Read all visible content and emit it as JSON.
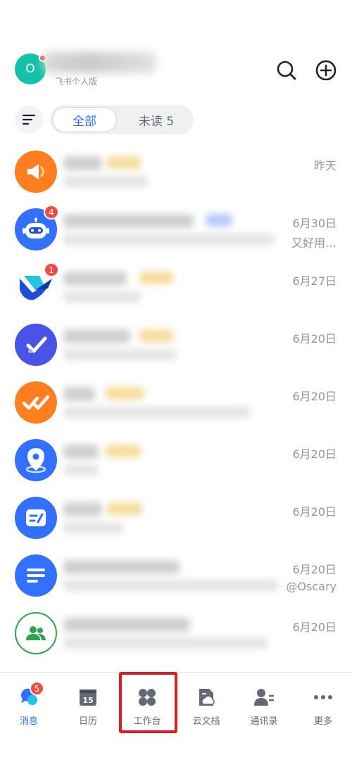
{
  "header": {
    "avatar_letter": "O",
    "org_label": "飞书个人版",
    "search_icon": "search-icon",
    "add_icon": "add-circle-icon"
  },
  "filters": {
    "all_label": "全部",
    "unread_label": "未读 5"
  },
  "chats": [
    {
      "time": "昨天",
      "preview": "",
      "badge": "",
      "icon": "megaphone-icon",
      "color": "#ff7f1e"
    },
    {
      "time": "6月30日",
      "preview": "又好用…",
      "badge": "4",
      "icon": "robot-icon",
      "color": "#3370ff"
    },
    {
      "time": "6月27日",
      "preview": "",
      "badge": "1",
      "icon": "lark-logo-icon",
      "color": "#ffffff"
    },
    {
      "time": "6月20日",
      "preview": "",
      "badge": "",
      "icon": "check-icon",
      "color": "#4954e6"
    },
    {
      "time": "6月20日",
      "preview": "",
      "badge": "",
      "icon": "double-check-icon",
      "color": "#ff7f1e"
    },
    {
      "time": "6月20日",
      "preview": "",
      "badge": "",
      "icon": "location-pin-icon",
      "color": "#3370ff"
    },
    {
      "time": "6月20日",
      "preview": "",
      "badge": "",
      "icon": "note-edit-icon",
      "color": "#3370ff"
    },
    {
      "time": "6月20日",
      "preview": "@Oscary",
      "badge": "",
      "icon": "doc-lines-icon",
      "color": "#3370ff"
    },
    {
      "time": "6月20日",
      "preview": "",
      "badge": "",
      "icon": "group-icon",
      "color": "#ffffff"
    }
  ],
  "nav": {
    "messages": {
      "label": "消息",
      "badge": "5"
    },
    "calendar": {
      "label": "日历",
      "day": "15"
    },
    "workplace": {
      "label": "工作台"
    },
    "docs": {
      "label": "云文档"
    },
    "contacts": {
      "label": "通讯录"
    },
    "more": {
      "label": "更多"
    }
  },
  "colors": {
    "accent": "#3370ff",
    "badge": "#f54a45",
    "highlight": "#e01b24"
  }
}
